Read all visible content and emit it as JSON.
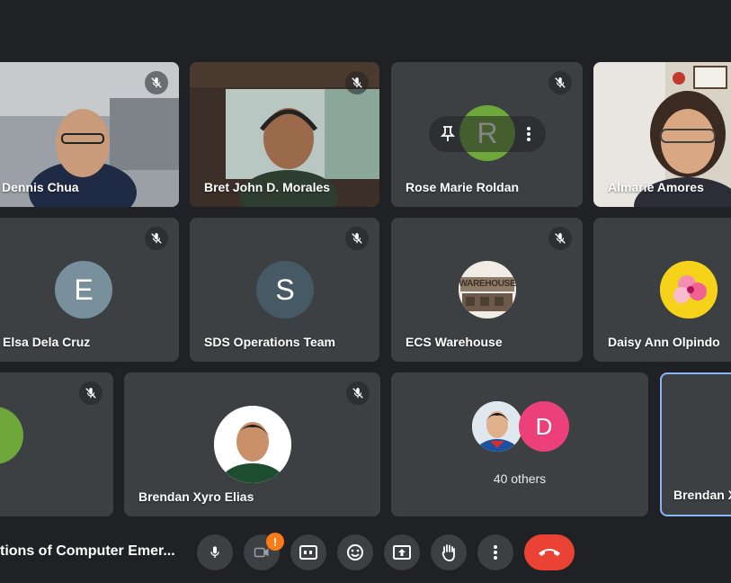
{
  "participants": [
    {
      "name": "Dennis Chua"
    },
    {
      "name": "Bret John D. Morales"
    },
    {
      "name": "Rose Marie Roldan",
      "initial": "R"
    },
    {
      "name": "Almarie Amores"
    },
    {
      "name": "Elsa Dela Cruz",
      "initial": "E"
    },
    {
      "name": "SDS Operations Team",
      "initial": "S"
    },
    {
      "name": "ECS Warehouse",
      "avatar_text": "WAREHOUSE"
    },
    {
      "name": "Daisy Ann Olpindo"
    },
    {
      "name": "Brendan Xyro Elias"
    },
    {
      "name": "Brendan X"
    }
  ],
  "others": {
    "label": "40 others",
    "initial": "D"
  },
  "meeting": {
    "title": "tions of Computer Emer..."
  },
  "controls": {
    "camera_badge": "!"
  },
  "colors": {
    "background": "#202124",
    "tile": "#3c4043",
    "end_call": "#ea4335",
    "active_border": "#8ab4f8",
    "avatar_elsa": "#78909c",
    "avatar_sds": "#455a64",
    "avatar_rose": "#6fa83a",
    "avatar_others": "#ec407a",
    "warning": "#fa7b17"
  },
  "icons": [
    "mic-off-icon",
    "pin-icon",
    "more-vert-icon",
    "mic-icon",
    "camera-off-icon",
    "captions-icon",
    "emoji-icon",
    "present-icon",
    "hand-icon",
    "end-call-icon"
  ]
}
